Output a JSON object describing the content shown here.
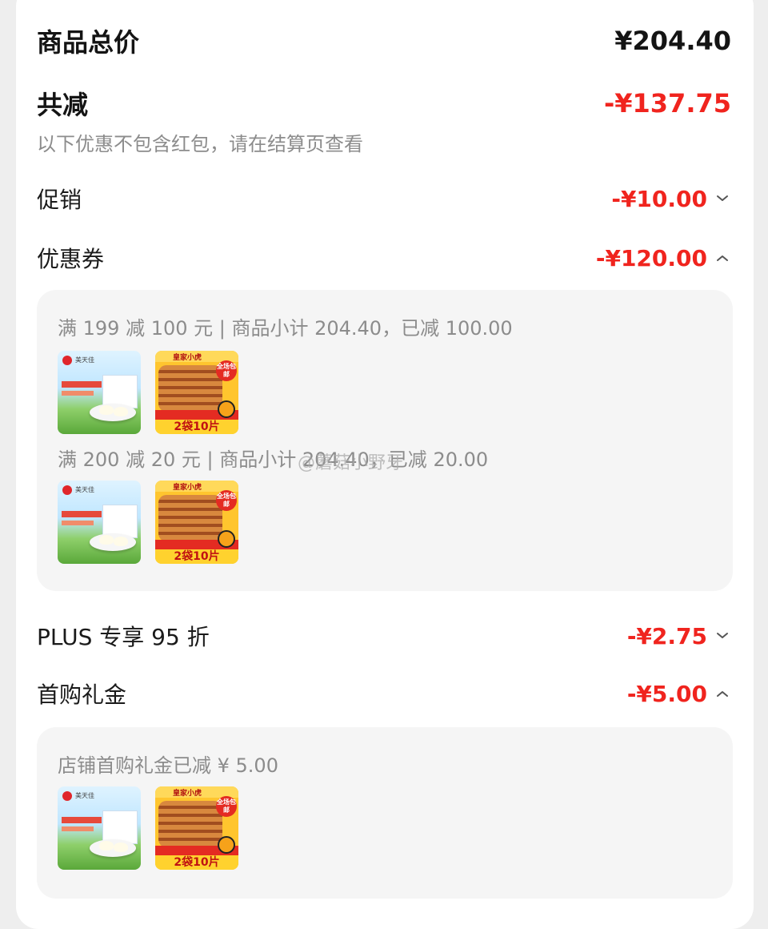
{
  "summary": {
    "total_label": "商品总价",
    "total_value": "¥204.40",
    "discount_label": "共减",
    "discount_value": "-¥137.75",
    "note": "以下优惠不包含红包，请在结算页查看"
  },
  "items": [
    {
      "label": "促销",
      "value": "-¥10.00",
      "expanded": false
    },
    {
      "label": "优惠券",
      "value": "-¥120.00",
      "expanded": true
    },
    {
      "label": "PLUS 专享 95 折",
      "value": "-¥2.75",
      "expanded": false
    },
    {
      "label": "首购礼金",
      "value": "-¥5.00",
      "expanded": true
    }
  ],
  "coupon_panel": {
    "lines": [
      "满 199 减 100 元 | 商品小计 204.40，已减 100.00",
      "满 200 减 20 元 | 商品小计 204.40，已减 20.00"
    ]
  },
  "gift_panel": {
    "line": "店铺首购礼金已减 ¥ 5.00"
  },
  "product_thumbs": {
    "dumpling_brand": "美天佳",
    "pancake_brand": "皇家小虎",
    "pancake_badge": "全场包邮",
    "pancake_bottom": "2袋10片"
  },
  "watermark": "@蘑菇小野牙",
  "icons": {
    "collapse": "chevron-down-icon",
    "expand": "chevron-up-icon"
  },
  "colors": {
    "accent_red": "#f0241e"
  }
}
